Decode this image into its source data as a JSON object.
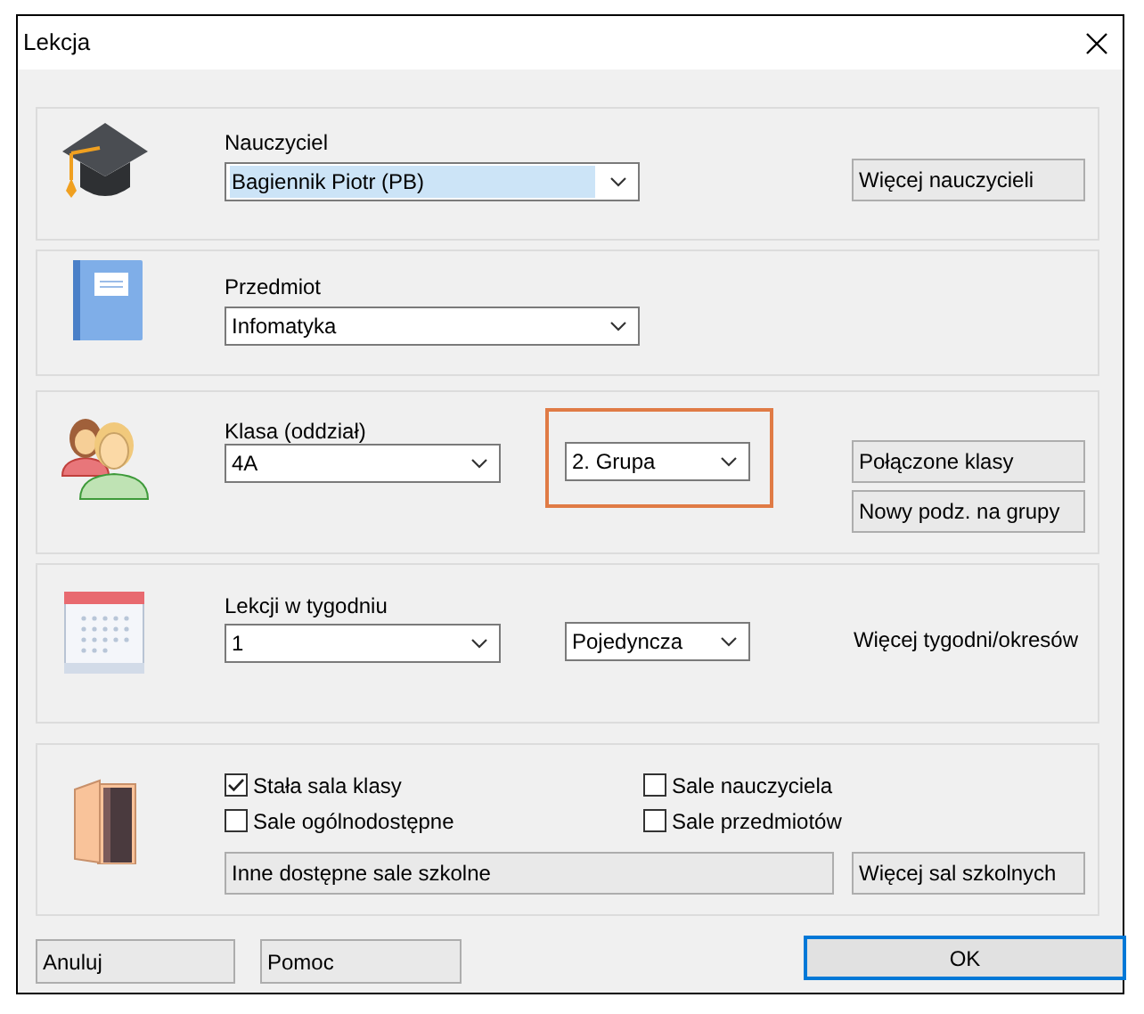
{
  "window": {
    "title": "Lekcja"
  },
  "teacher": {
    "label": "Nauczyciel",
    "value": "Bagiennik Piotr (PB)",
    "selected": true,
    "more_button": "Więcej nauczycieli"
  },
  "subject": {
    "label": "Przedmiot",
    "value": "Infomatyka",
    "selected": false
  },
  "class": {
    "label": "Klasa (oddział)",
    "value": "4A",
    "group": {
      "value": "2. Grupa",
      "highlighted": true
    },
    "buttons": [
      "Połączone klasy",
      "Nowy podz. na grupy"
    ]
  },
  "lessons": {
    "label": "Lekcji w tygodniu",
    "value": "1",
    "type": "Pojedyncza",
    "more_link": "Więcej tygodni/okresów"
  },
  "rooms": {
    "checkboxes": [
      {
        "label": "Stała sala klasy",
        "checked": true
      },
      {
        "label": "Sale nauczyciela",
        "checked": false
      },
      {
        "label": "Sale ogólnodostępne",
        "checked": false
      },
      {
        "label": "Sale przedmiotów",
        "checked": false
      }
    ],
    "other_button": "Inne dostępne sale szkolne",
    "more_button": "Więcej sal szkolnych"
  },
  "buttons": [
    {
      "label": "Anuluj",
      "default": false
    },
    {
      "label": "Pomoc",
      "default": false
    },
    {
      "label": "OK",
      "default": true
    }
  ]
}
